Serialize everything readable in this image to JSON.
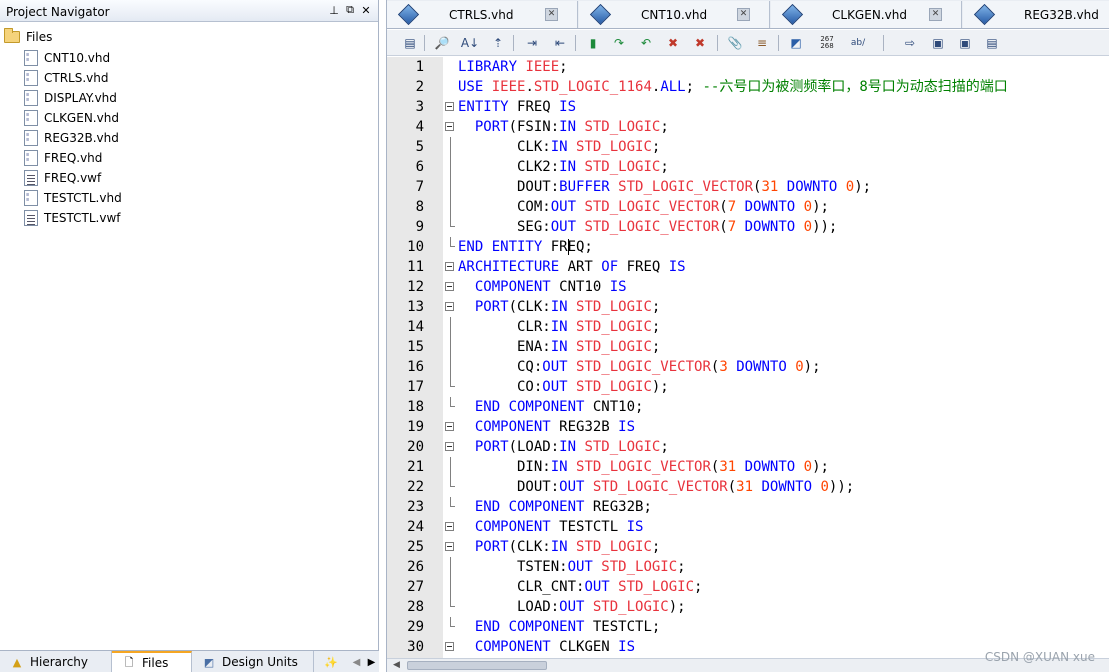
{
  "navigator": {
    "title": "Project Navigator",
    "root_label": "Files",
    "files": [
      {
        "name": "CNT10.vhd",
        "kind": "vhd"
      },
      {
        "name": "CTRLS.vhd",
        "kind": "vhd"
      },
      {
        "name": "DISPLAY.vhd",
        "kind": "vhd"
      },
      {
        "name": "CLKGEN.vhd",
        "kind": "vhd"
      },
      {
        "name": "REG32B.vhd",
        "kind": "vhd"
      },
      {
        "name": "FREQ.vhd",
        "kind": "vhd"
      },
      {
        "name": "FREQ.vwf",
        "kind": "vwf"
      },
      {
        "name": "TESTCTL.vhd",
        "kind": "vhd"
      },
      {
        "name": "TESTCTL.vwf",
        "kind": "vwf"
      }
    ],
    "bottom_tabs": [
      {
        "label": "Hierarchy",
        "icon": "hierarchy-icon"
      },
      {
        "label": "Files",
        "icon": "files-icon",
        "active": true
      },
      {
        "label": "Design Units",
        "icon": "design-units-icon"
      }
    ]
  },
  "editor": {
    "tabs": [
      {
        "label": "CTRLS.vhd"
      },
      {
        "label": "CNT10.vhd"
      },
      {
        "label": "CLKGEN.vhd"
      },
      {
        "label": "REG32B.vhd"
      }
    ],
    "toolbar_number_icon_text": [
      "267",
      "268"
    ],
    "toolbar_ab_text": "ab/",
    "lines": [
      {
        "n": "1",
        "fold": "",
        "segs": [
          [
            "k",
            "LIBRARY "
          ],
          [
            "t",
            "IEEE"
          ],
          [
            "p",
            ";"
          ]
        ]
      },
      {
        "n": "2",
        "fold": "",
        "segs": [
          [
            "k",
            "USE "
          ],
          [
            "t",
            "IEEE"
          ],
          [
            "p",
            "."
          ],
          [
            "t",
            "STD_LOGIC_1164"
          ],
          [
            "p",
            "."
          ],
          [
            "k",
            "ALL"
          ],
          [
            "p",
            "; "
          ],
          [
            "c",
            "--六号口为被测频率口，8号口为动态扫描的端口"
          ]
        ]
      },
      {
        "n": "3",
        "fold": "box0",
        "segs": [
          [
            "k",
            "ENTITY "
          ],
          [
            "p",
            "FREQ "
          ],
          [
            "k",
            "IS"
          ]
        ]
      },
      {
        "n": "4",
        "fold": "box1",
        "segs": [
          [
            "p",
            "  "
          ],
          [
            "k",
            "PORT"
          ],
          [
            "p",
            "(FSIN:"
          ],
          [
            "k",
            "IN "
          ],
          [
            "t",
            "STD_LOGIC"
          ],
          [
            "p",
            ";"
          ]
        ]
      },
      {
        "n": "5",
        "fold": "bar",
        "segs": [
          [
            "p",
            "       CLK:"
          ],
          [
            "k",
            "IN "
          ],
          [
            "t",
            "STD_LOGIC"
          ],
          [
            "p",
            ";"
          ]
        ]
      },
      {
        "n": "6",
        "fold": "bar",
        "segs": [
          [
            "p",
            "       CLK2:"
          ],
          [
            "k",
            "IN "
          ],
          [
            "t",
            "STD_LOGIC"
          ],
          [
            "p",
            ";"
          ]
        ]
      },
      {
        "n": "7",
        "fold": "bar",
        "segs": [
          [
            "p",
            "       DOUT:"
          ],
          [
            "k",
            "BUFFER "
          ],
          [
            "t",
            "STD_LOGIC_VECTOR"
          ],
          [
            "p",
            "("
          ],
          [
            "n",
            "31"
          ],
          [
            "p",
            " "
          ],
          [
            "k",
            "DOWNTO "
          ],
          [
            "n",
            "0"
          ],
          [
            "p",
            ");"
          ]
        ]
      },
      {
        "n": "8",
        "fold": "bar",
        "segs": [
          [
            "p",
            "       COM:"
          ],
          [
            "k",
            "OUT "
          ],
          [
            "t",
            "STD_LOGIC_VECTOR"
          ],
          [
            "p",
            "("
          ],
          [
            "n",
            "7"
          ],
          [
            "p",
            " "
          ],
          [
            "k",
            "DOWNTO "
          ],
          [
            "n",
            "0"
          ],
          [
            "p",
            ");"
          ]
        ]
      },
      {
        "n": "9",
        "fold": "end",
        "segs": [
          [
            "p",
            "       SEG:"
          ],
          [
            "k",
            "OUT "
          ],
          [
            "t",
            "STD_LOGIC_VECTOR"
          ],
          [
            "p",
            "("
          ],
          [
            "n",
            "7"
          ],
          [
            "p",
            " "
          ],
          [
            "k",
            "DOWNTO "
          ],
          [
            "n",
            "0"
          ],
          [
            "p",
            "));"
          ]
        ]
      },
      {
        "n": "10",
        "fold": "end",
        "segs": [
          [
            "k",
            "END ENTITY "
          ],
          [
            "p",
            "FREQ;"
          ]
        ]
      },
      {
        "n": "11",
        "fold": "box0",
        "segs": [
          [
            "k",
            "ARCHITECTURE "
          ],
          [
            "p",
            "ART "
          ],
          [
            "k",
            "OF "
          ],
          [
            "p",
            "FREQ "
          ],
          [
            "k",
            "IS"
          ]
        ]
      },
      {
        "n": "12",
        "fold": "box1",
        "segs": [
          [
            "p",
            "  "
          ],
          [
            "k",
            "COMPONENT "
          ],
          [
            "p",
            "CNT10 "
          ],
          [
            "k",
            "IS"
          ]
        ]
      },
      {
        "n": "13",
        "fold": "box1",
        "segs": [
          [
            "p",
            "  "
          ],
          [
            "k",
            "PORT"
          ],
          [
            "p",
            "(CLK:"
          ],
          [
            "k",
            "IN "
          ],
          [
            "t",
            "STD_LOGIC"
          ],
          [
            "p",
            ";"
          ]
        ]
      },
      {
        "n": "14",
        "fold": "bar",
        "segs": [
          [
            "p",
            "       CLR:"
          ],
          [
            "k",
            "IN "
          ],
          [
            "t",
            "STD_LOGIC"
          ],
          [
            "p",
            ";"
          ]
        ]
      },
      {
        "n": "15",
        "fold": "bar",
        "segs": [
          [
            "p",
            "       ENA:"
          ],
          [
            "k",
            "IN "
          ],
          [
            "t",
            "STD_LOGIC"
          ],
          [
            "p",
            ";"
          ]
        ]
      },
      {
        "n": "16",
        "fold": "bar",
        "segs": [
          [
            "p",
            "       CQ:"
          ],
          [
            "k",
            "OUT "
          ],
          [
            "t",
            "STD_LOGIC_VECTOR"
          ],
          [
            "p",
            "("
          ],
          [
            "n",
            "3"
          ],
          [
            "p",
            " "
          ],
          [
            "k",
            "DOWNTO "
          ],
          [
            "n",
            "0"
          ],
          [
            "p",
            ");"
          ]
        ]
      },
      {
        "n": "17",
        "fold": "end",
        "segs": [
          [
            "p",
            "       CO:"
          ],
          [
            "k",
            "OUT "
          ],
          [
            "t",
            "STD_LOGIC"
          ],
          [
            "p",
            ");"
          ]
        ]
      },
      {
        "n": "18",
        "fold": "end",
        "segs": [
          [
            "p",
            "  "
          ],
          [
            "k",
            "END COMPONENT "
          ],
          [
            "p",
            "CNT10;"
          ]
        ]
      },
      {
        "n": "19",
        "fold": "box1",
        "segs": [
          [
            "p",
            "  "
          ],
          [
            "k",
            "COMPONENT "
          ],
          [
            "p",
            "REG32B "
          ],
          [
            "k",
            "IS"
          ]
        ]
      },
      {
        "n": "20",
        "fold": "box1",
        "segs": [
          [
            "p",
            "  "
          ],
          [
            "k",
            "PORT"
          ],
          [
            "p",
            "(LOAD:"
          ],
          [
            "k",
            "IN "
          ],
          [
            "t",
            "STD_LOGIC"
          ],
          [
            "p",
            ";"
          ]
        ]
      },
      {
        "n": "21",
        "fold": "bar",
        "segs": [
          [
            "p",
            "       DIN:"
          ],
          [
            "k",
            "IN "
          ],
          [
            "t",
            "STD_LOGIC_VECTOR"
          ],
          [
            "p",
            "("
          ],
          [
            "n",
            "31"
          ],
          [
            "p",
            " "
          ],
          [
            "k",
            "DOWNTO "
          ],
          [
            "n",
            "0"
          ],
          [
            "p",
            ");"
          ]
        ]
      },
      {
        "n": "22",
        "fold": "end",
        "segs": [
          [
            "p",
            "       DOUT:"
          ],
          [
            "k",
            "OUT "
          ],
          [
            "t",
            "STD_LOGIC_VECTOR"
          ],
          [
            "p",
            "("
          ],
          [
            "n",
            "31"
          ],
          [
            "p",
            " "
          ],
          [
            "k",
            "DOWNTO "
          ],
          [
            "n",
            "0"
          ],
          [
            "p",
            "));"
          ]
        ]
      },
      {
        "n": "23",
        "fold": "end",
        "segs": [
          [
            "p",
            "  "
          ],
          [
            "k",
            "END COMPONENT "
          ],
          [
            "p",
            "REG32B;"
          ]
        ]
      },
      {
        "n": "24",
        "fold": "box1",
        "segs": [
          [
            "p",
            "  "
          ],
          [
            "k",
            "COMPONENT "
          ],
          [
            "p",
            "TESTCTL "
          ],
          [
            "k",
            "IS"
          ]
        ]
      },
      {
        "n": "25",
        "fold": "box1",
        "segs": [
          [
            "p",
            "  "
          ],
          [
            "k",
            "PORT"
          ],
          [
            "p",
            "(CLK:"
          ],
          [
            "k",
            "IN "
          ],
          [
            "t",
            "STD_LOGIC"
          ],
          [
            "p",
            ";"
          ]
        ]
      },
      {
        "n": "26",
        "fold": "bar",
        "segs": [
          [
            "p",
            "       TSTEN:"
          ],
          [
            "k",
            "OUT "
          ],
          [
            "t",
            "STD_LOGIC"
          ],
          [
            "p",
            ";"
          ]
        ]
      },
      {
        "n": "27",
        "fold": "bar",
        "segs": [
          [
            "p",
            "       CLR_CNT:"
          ],
          [
            "k",
            "OUT "
          ],
          [
            "t",
            "STD_LOGIC"
          ],
          [
            "p",
            ";"
          ]
        ]
      },
      {
        "n": "28",
        "fold": "end",
        "segs": [
          [
            "p",
            "       LOAD:"
          ],
          [
            "k",
            "OUT "
          ],
          [
            "t",
            "STD_LOGIC"
          ],
          [
            "p",
            ");"
          ]
        ]
      },
      {
        "n": "29",
        "fold": "end",
        "segs": [
          [
            "p",
            "  "
          ],
          [
            "k",
            "END COMPONENT "
          ],
          [
            "p",
            "TESTCTL;"
          ]
        ]
      },
      {
        "n": "30",
        "fold": "box1",
        "segs": [
          [
            "p",
            "  "
          ],
          [
            "k",
            "COMPONENT "
          ],
          [
            "p",
            "CLKGEN "
          ],
          [
            "k",
            "IS"
          ]
        ]
      }
    ]
  },
  "watermark": "CSDN @XUAN xue"
}
